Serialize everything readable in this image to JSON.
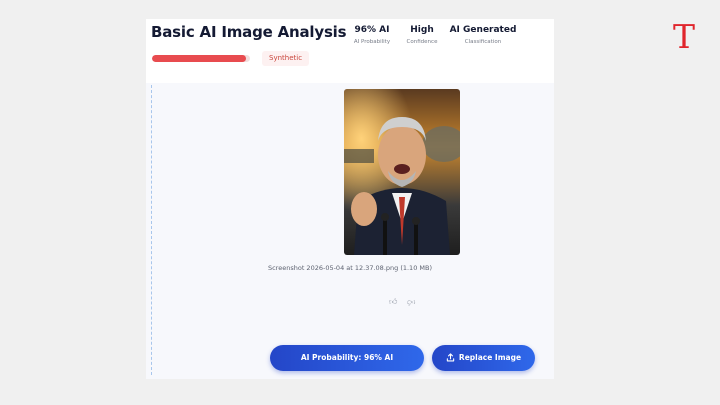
{
  "header": {
    "title": "Basic AI Image Analysis",
    "verdict_badge": "Synthetic",
    "ai_probability_percent": 96,
    "stats": [
      {
        "value": "96% AI",
        "label": "AI Probability"
      },
      {
        "value": "High",
        "label": "Confidence"
      },
      {
        "value": "AI Generated",
        "label": "Classification"
      }
    ]
  },
  "image": {
    "filename": "Screenshot 2026-05-04 at 12.37.08.png (1.10 MB)"
  },
  "feedback": {
    "thumbs_up_icon": "thumbs-up-icon",
    "thumbs_down_icon": "thumbs-down-icon"
  },
  "actions": {
    "probability_button": "AI Probability: 96% AI",
    "replace_button": "Replace Image",
    "replace_icon": "upload-icon"
  },
  "logo": {
    "letter": "T"
  },
  "colors": {
    "accent": "#2446c8",
    "danger": "#e84b4f",
    "logo": "#e0252c"
  }
}
